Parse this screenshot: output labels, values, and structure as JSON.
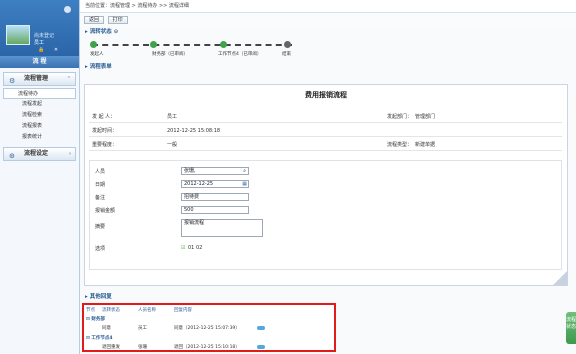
{
  "sidebar": {
    "welcome": "尚未登记",
    "user_name": "员工",
    "user_icons": "🔒 ✕",
    "main_menu": "流 程",
    "groups": [
      {
        "label": "流程管理",
        "items": [
          "流程待办",
          "流程发起",
          "流程检索",
          "流程报表",
          "报表统计"
        ]
      },
      {
        "label": "流程设定",
        "items": []
      }
    ]
  },
  "breadcrumb": "当前位置：流程管理 > 流程待办 >> 流程详细",
  "toolbar": {
    "back_label": "返回",
    "print_label": "打印"
  },
  "flow_status": {
    "title": "流转状态",
    "steps": [
      "发起人",
      "财务部（已审阅）",
      "工作节点4（已审阅）",
      "结束"
    ]
  },
  "flow_form": {
    "section_title": "流程表单",
    "title": "费用报销流程",
    "info_rows": [
      {
        "label": "发 起 人：",
        "value": "员工",
        "label2": "发起部门：",
        "value2": "管理部门"
      },
      {
        "label": "发起时间：",
        "value": "2012-12-25 15:08:18",
        "label2": "",
        "value2": ""
      },
      {
        "label": "重要程度：",
        "value": "一般",
        "label2": "流程类型：",
        "value2": "新建单据"
      }
    ],
    "fields": [
      {
        "label": "人员",
        "value": "张珊,"
      },
      {
        "label": "日期",
        "value": "2012-12-25"
      },
      {
        "label": "备注",
        "value": "招待费"
      },
      {
        "label": "报销金额",
        "value": "500"
      },
      {
        "label": "摘要",
        "value": "报销流程"
      },
      {
        "label": "选项",
        "value": "01  02"
      }
    ]
  },
  "comments": {
    "section_title": "其他回复",
    "headers": [
      "节点",
      "流转状态",
      "人员名称",
      "回复内容"
    ],
    "nodes": [
      {
        "name": "财务部",
        "status": "同意",
        "person": "员工",
        "content": "同意（2012-12-25 15:07:39）"
      },
      {
        "name": "工作节点4",
        "status": "退回重发",
        "person": "张珊",
        "content": "退回（2012-12-25 15:10:18）"
      }
    ]
  },
  "side_tab": "流程状态",
  "colors": {
    "accent": "#2b5c92",
    "highlight_border": "#e31a1a"
  }
}
